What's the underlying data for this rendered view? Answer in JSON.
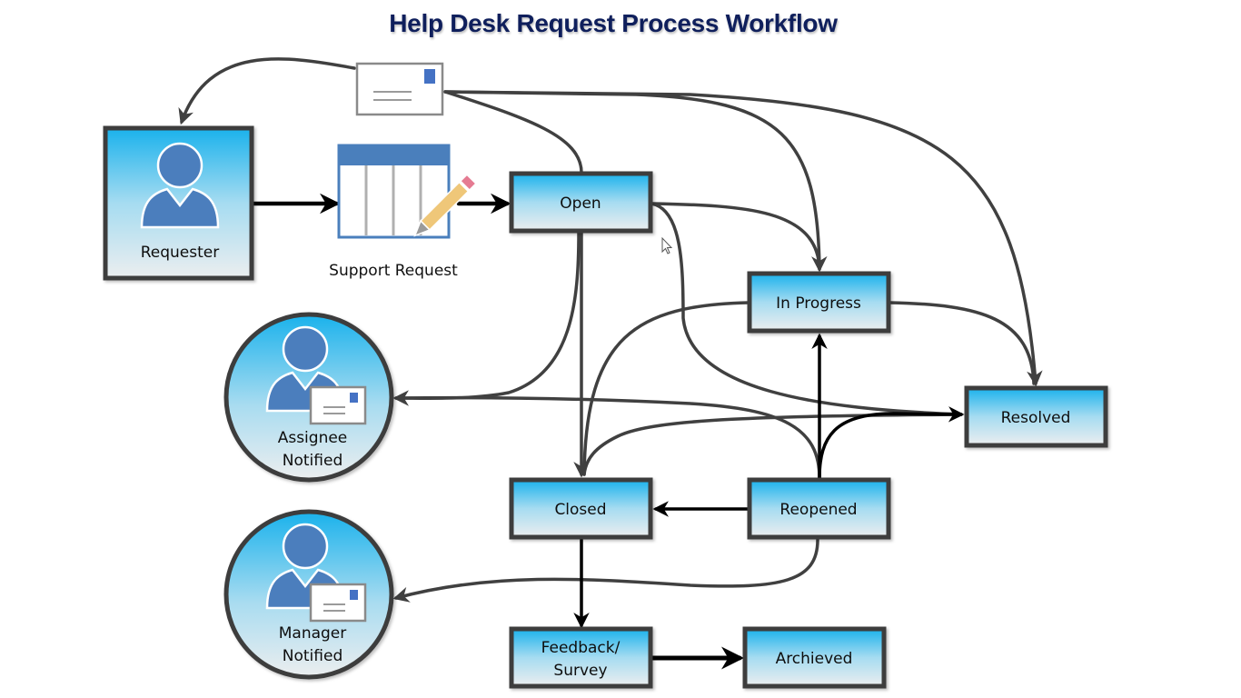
{
  "title": "Help Desk Request Process Workflow",
  "colors": {
    "title": "#0f1f5c",
    "gradient_top": "#1ab2ec",
    "gradient_bottom": "#eceeef",
    "border": "#3d3d3d",
    "connector": "#404040",
    "connector_strong": "#000000",
    "person_icon": "#4b7ebd",
    "envelope_stamp": "#4472c4",
    "form_header": "#4a7fbc",
    "pencil_body": "#efc779",
    "pencil_eraser": "#e57b92"
  },
  "nodes": {
    "requester": {
      "label": "Requester",
      "icon": "person-icon"
    },
    "support_request": {
      "label": "Support Request",
      "icon": "form-with-pencil-icon"
    },
    "email": {
      "icon": "envelope-icon"
    },
    "open": {
      "label": "Open"
    },
    "in_progress": {
      "label": "In Progress"
    },
    "resolved": {
      "label": "Resolved"
    },
    "assignee_notified": {
      "label_line1": "Assignee",
      "label_line2": "Notified",
      "icon": "person-with-envelope-icon"
    },
    "closed": {
      "label": "Closed"
    },
    "reopened": {
      "label": "Reopened"
    },
    "manager_notified": {
      "label_line1": "Manager",
      "label_line2": "Notified",
      "icon": "person-with-envelope-icon"
    },
    "feedback": {
      "label_line1": "Feedback/",
      "label_line2": "Survey"
    },
    "archived": {
      "label": "Archieved"
    }
  },
  "edges": [
    {
      "from": "email",
      "to": "requester"
    },
    {
      "from": "requester",
      "to": "support_request"
    },
    {
      "from": "support_request",
      "to": "open"
    },
    {
      "from": "open",
      "to": "email"
    },
    {
      "from": "email",
      "to": "in_progress"
    },
    {
      "from": "email",
      "to": "resolved"
    },
    {
      "from": "open",
      "to": "in_progress"
    },
    {
      "from": "open",
      "to": "resolved"
    },
    {
      "from": "open",
      "to": "assignee_notified"
    },
    {
      "from": "open",
      "to": "closed"
    },
    {
      "from": "in_progress",
      "to": "resolved"
    },
    {
      "from": "in_progress",
      "to": "closed"
    },
    {
      "from": "reopened",
      "to": "in_progress"
    },
    {
      "from": "reopened",
      "to": "resolved"
    },
    {
      "from": "reopened",
      "to": "assignee_notified"
    },
    {
      "from": "resolved",
      "to": "closed"
    },
    {
      "from": "reopened",
      "to": "closed"
    },
    {
      "from": "reopened",
      "to": "manager_notified"
    },
    {
      "from": "closed",
      "to": "feedback"
    },
    {
      "from": "feedback",
      "to": "archived"
    }
  ]
}
